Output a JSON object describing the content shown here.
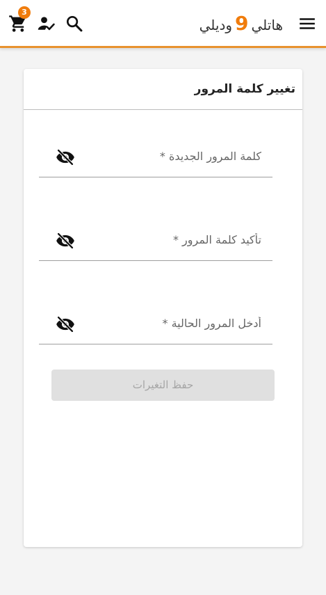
{
  "header": {
    "brand_word_left": "ودیلي",
    "brand_number": "9",
    "brand_word_right": "هاتلي",
    "cart_count": "3",
    "accent_color": "#e8922e",
    "badge_color": "#f07c0c",
    "icons": [
      "cart-icon",
      "user-check-icon",
      "search-icon",
      "menu-icon"
    ]
  },
  "form": {
    "title": "تغيير كلمة المرور",
    "fields": [
      {
        "placeholder": "كلمة المرور الجديدة *",
        "value": "",
        "icon": "eye-off-icon"
      },
      {
        "placeholder": "تأكيد كلمة المرور *",
        "value": "",
        "icon": "eye-off-icon"
      },
      {
        "placeholder": "أدخل المرور الحالية *",
        "value": "",
        "icon": "eye-off-icon"
      }
    ],
    "save_label": "حفظ التغيرات"
  }
}
